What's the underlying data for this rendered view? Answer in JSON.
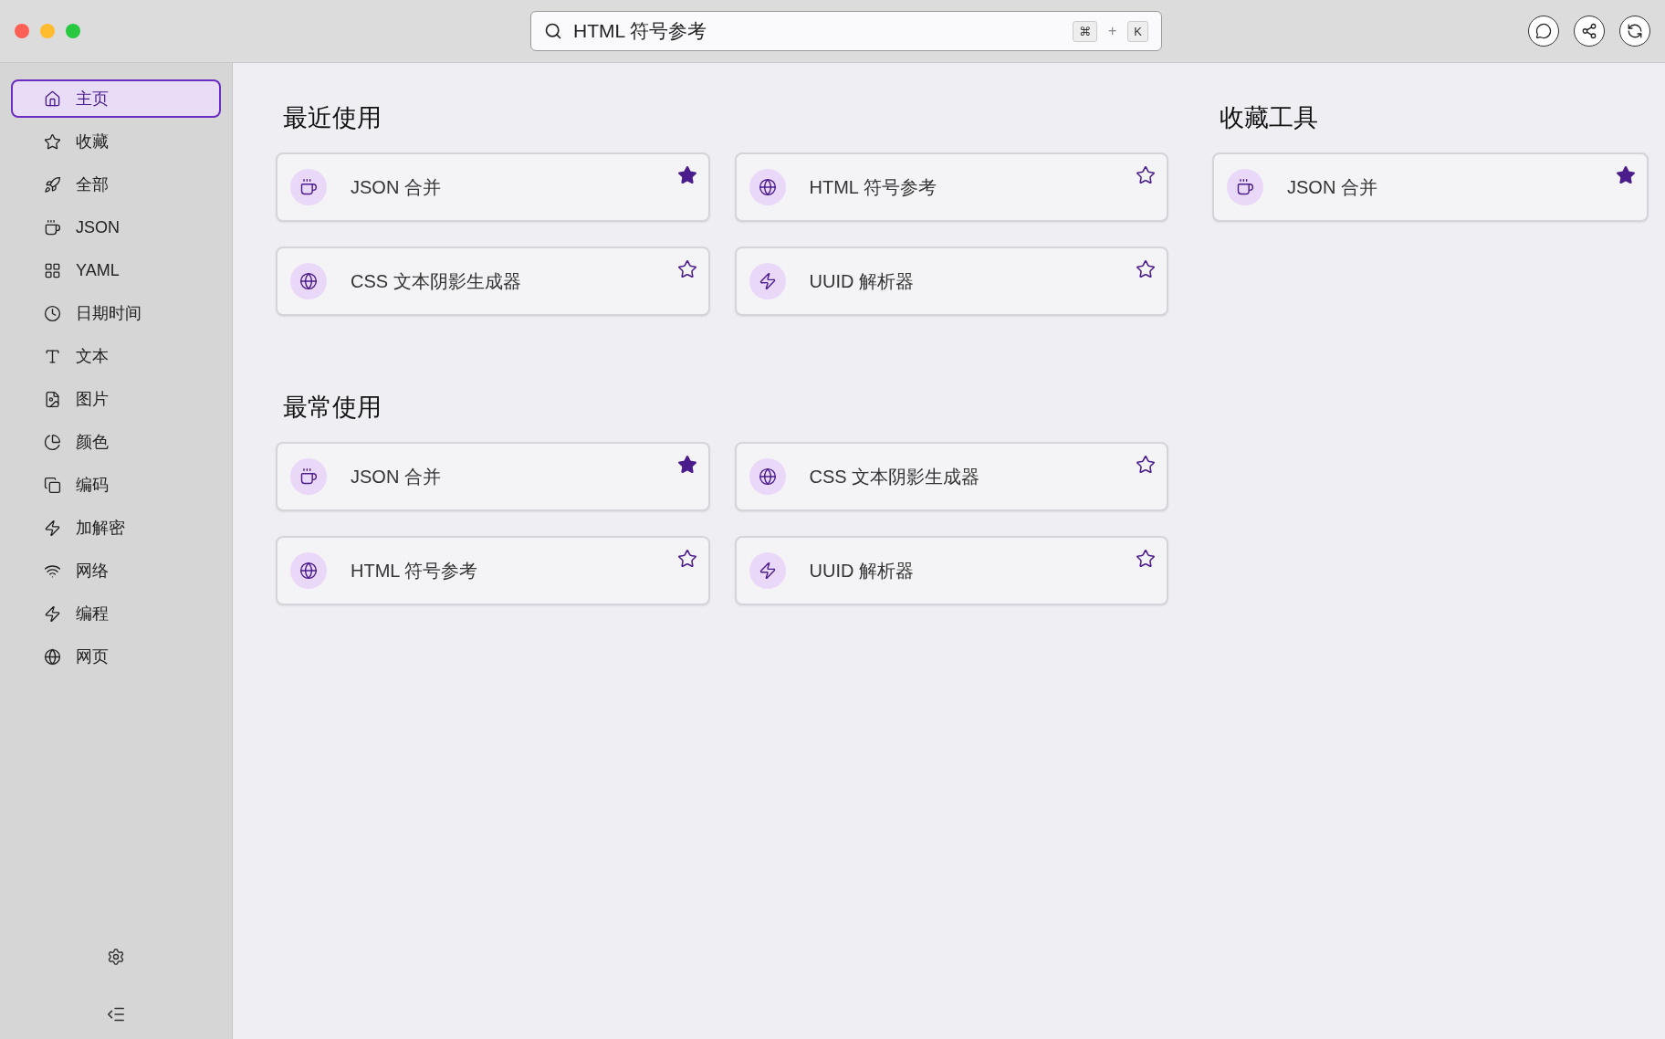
{
  "search": {
    "value": "HTML 符号参考",
    "shortcut": [
      "⌘",
      "+",
      "K"
    ]
  },
  "sidebar": {
    "items": [
      {
        "label": "主页",
        "selected": true
      },
      {
        "label": "收藏",
        "selected": false
      },
      {
        "label": "全部",
        "selected": false
      },
      {
        "label": "JSON",
        "selected": false
      },
      {
        "label": "YAML",
        "selected": false
      },
      {
        "label": "日期时间",
        "selected": false
      },
      {
        "label": "文本",
        "selected": false
      },
      {
        "label": "图片",
        "selected": false
      },
      {
        "label": "颜色",
        "selected": false
      },
      {
        "label": "编码",
        "selected": false
      },
      {
        "label": "加解密",
        "selected": false
      },
      {
        "label": "网络",
        "selected": false
      },
      {
        "label": "编程",
        "selected": false
      },
      {
        "label": "网页",
        "selected": false
      }
    ]
  },
  "sections": [
    {
      "title": "最近使用",
      "cards": [
        {
          "title": "JSON 合并",
          "kind": "json",
          "starred": true
        },
        {
          "title": "HTML 符号参考",
          "kind": "web",
          "starred": false
        },
        {
          "title": "CSS 文本阴影生成器",
          "kind": "web",
          "starred": false
        },
        {
          "title": "UUID 解析器",
          "kind": "code",
          "starred": false
        }
      ]
    },
    {
      "title": "最常使用",
      "cards": [
        {
          "title": "JSON 合并",
          "kind": "json",
          "starred": true
        },
        {
          "title": "CSS 文本阴影生成器",
          "kind": "web",
          "starred": false
        },
        {
          "title": "HTML 符号参考",
          "kind": "web",
          "starred": false
        },
        {
          "title": "UUID 解析器",
          "kind": "code",
          "starred": false
        }
      ]
    }
  ],
  "favorites": {
    "title": "收藏工具",
    "cards": [
      {
        "title": "JSON 合并",
        "kind": "json",
        "starred": true
      }
    ]
  }
}
